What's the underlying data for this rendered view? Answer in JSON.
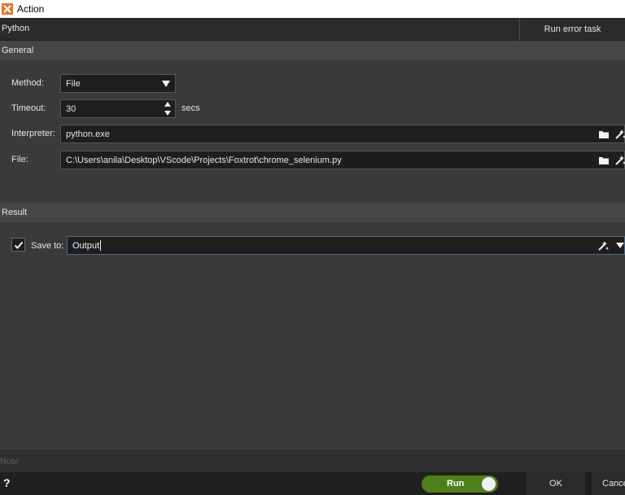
{
  "window": {
    "title": "Action",
    "app_icon": "x-icon",
    "app_icon_color": "#e8742a"
  },
  "header": {
    "action_name": "Python",
    "run_error_task_label": "Run error task"
  },
  "general": {
    "section_label": "General",
    "method": {
      "label": "Method:",
      "value": "File"
    },
    "timeout": {
      "label": "Timeout:",
      "value": "30",
      "unit": "secs"
    },
    "interpreter": {
      "label": "Interpreter:",
      "value": "python.exe"
    },
    "file": {
      "label": "File:",
      "value": "C:\\Users\\anila\\Desktop\\VScode\\Projects\\Foxtrot\\chrome_selenium.py"
    }
  },
  "result": {
    "section_label": "Result",
    "save_to": {
      "checked": true,
      "label": "Save to:",
      "value": "Output"
    }
  },
  "note": {
    "placeholder": "Note"
  },
  "footer": {
    "help_label": "?",
    "run_label": "Run",
    "run_color": "#4f7f1b",
    "ok_label": "OK",
    "cancel_label": "Cancel"
  },
  "icons": [
    "folder-icon",
    "magic-wand-icon",
    "chevron-down-icon",
    "checkmark-icon"
  ]
}
